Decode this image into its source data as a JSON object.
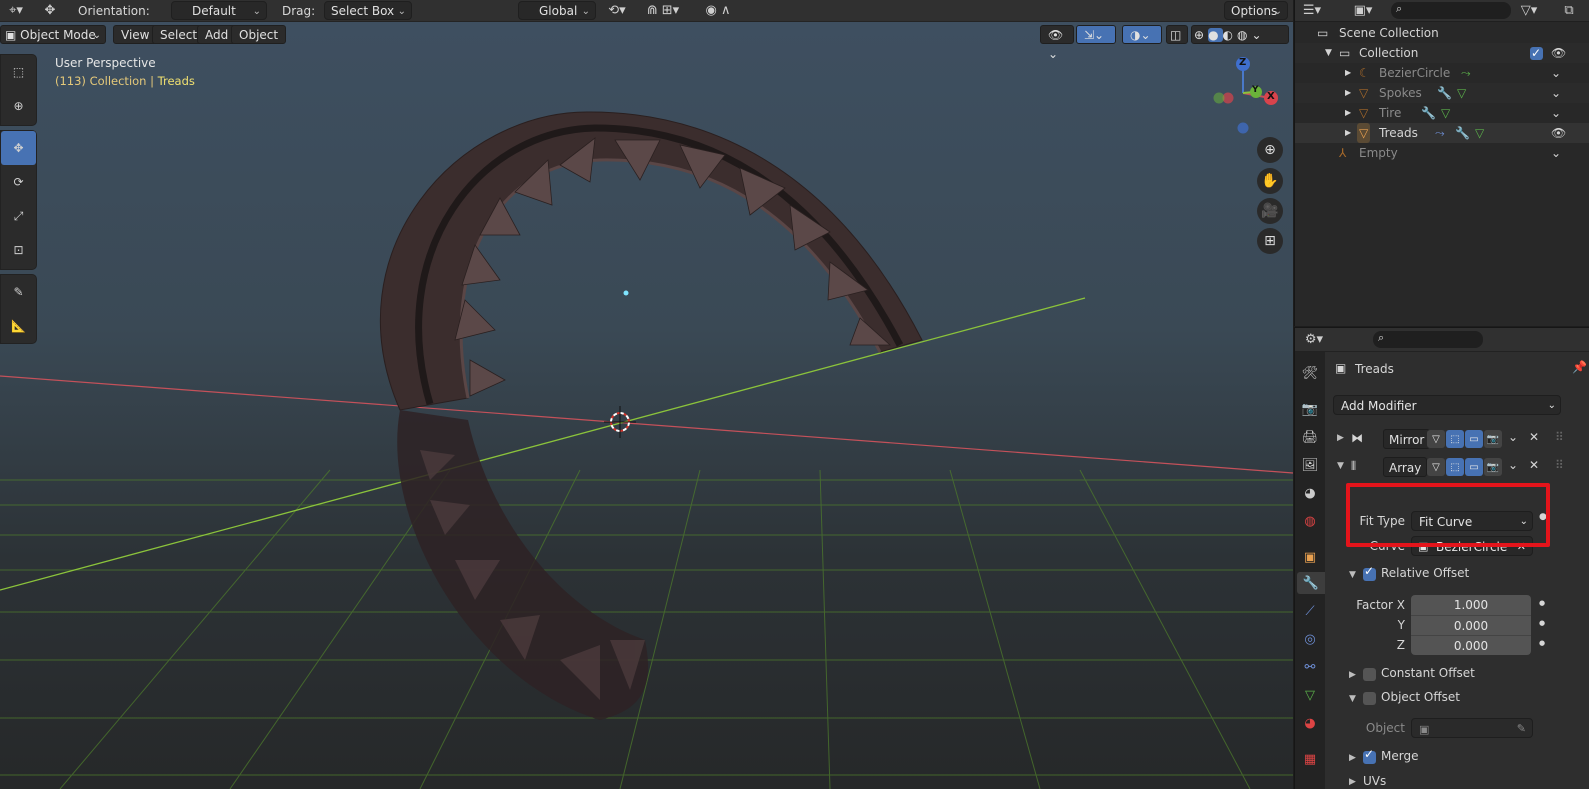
{
  "topbar": {
    "orientation_label": "Orientation:",
    "orientation_value": "Default",
    "drag_label": "Drag:",
    "drag_value": "Select Box",
    "transform_space": "Global",
    "options_label": "Options"
  },
  "viewport_header": {
    "mode": "Object Mode",
    "menus": [
      "View",
      "Select",
      "Add",
      "Object"
    ]
  },
  "viewport": {
    "view_name": "User Perspective",
    "context_prefix": "(113) Collection | ",
    "context_selected": "Treads",
    "gizmo_axes": {
      "z": "Z",
      "y": "Y",
      "x": "X"
    }
  },
  "toolbar": {
    "tools": [
      "select-box-icon",
      "cursor-icon",
      "move-icon",
      "rotate-icon",
      "scale-icon",
      "transform-icon",
      "annotate-icon",
      "measure-icon"
    ],
    "active_tool": "move-icon"
  },
  "outliner": {
    "rows": [
      {
        "label": "Scene Collection",
        "dim": false
      },
      {
        "label": "Collection",
        "dim": false
      },
      {
        "label": "BezierCircle",
        "dim": true
      },
      {
        "label": "Spokes",
        "dim": true
      },
      {
        "label": "Tire",
        "dim": true
      },
      {
        "label": "Treads",
        "dim": false
      },
      {
        "label": "Empty",
        "dim": true
      }
    ]
  },
  "properties": {
    "object_name": "Treads",
    "add_modifier_label": "Add Modifier",
    "modifiers": [
      {
        "name": "Mirror",
        "expanded": false
      },
      {
        "name": "Array",
        "expanded": true
      }
    ],
    "array": {
      "fit_type_label": "Fit Type",
      "fit_type_value": "Fit Curve",
      "curve_label": "Curve",
      "curve_value": "BezierCircle",
      "relative_offset_label": "Relative Offset",
      "relative_offset_checked": true,
      "factor_x_label": "Factor X",
      "factor_x": "1.000",
      "y_label": "Y",
      "y_value": "0.000",
      "z_label": "Z",
      "z_value": "0.000",
      "constant_offset_label": "Constant Offset",
      "constant_offset_checked": false,
      "object_offset_label": "Object Offset",
      "object_offset_checked": false,
      "object_label": "Object",
      "merge_label": "Merge",
      "merge_checked": true,
      "uvs_label": "UVs"
    }
  },
  "colors": {
    "accent": "#4772b3",
    "highlight": "#e4141b",
    "x_axis": "#c4515a",
    "y_axis": "#8bc33b",
    "selected_text": "#f0e070"
  }
}
